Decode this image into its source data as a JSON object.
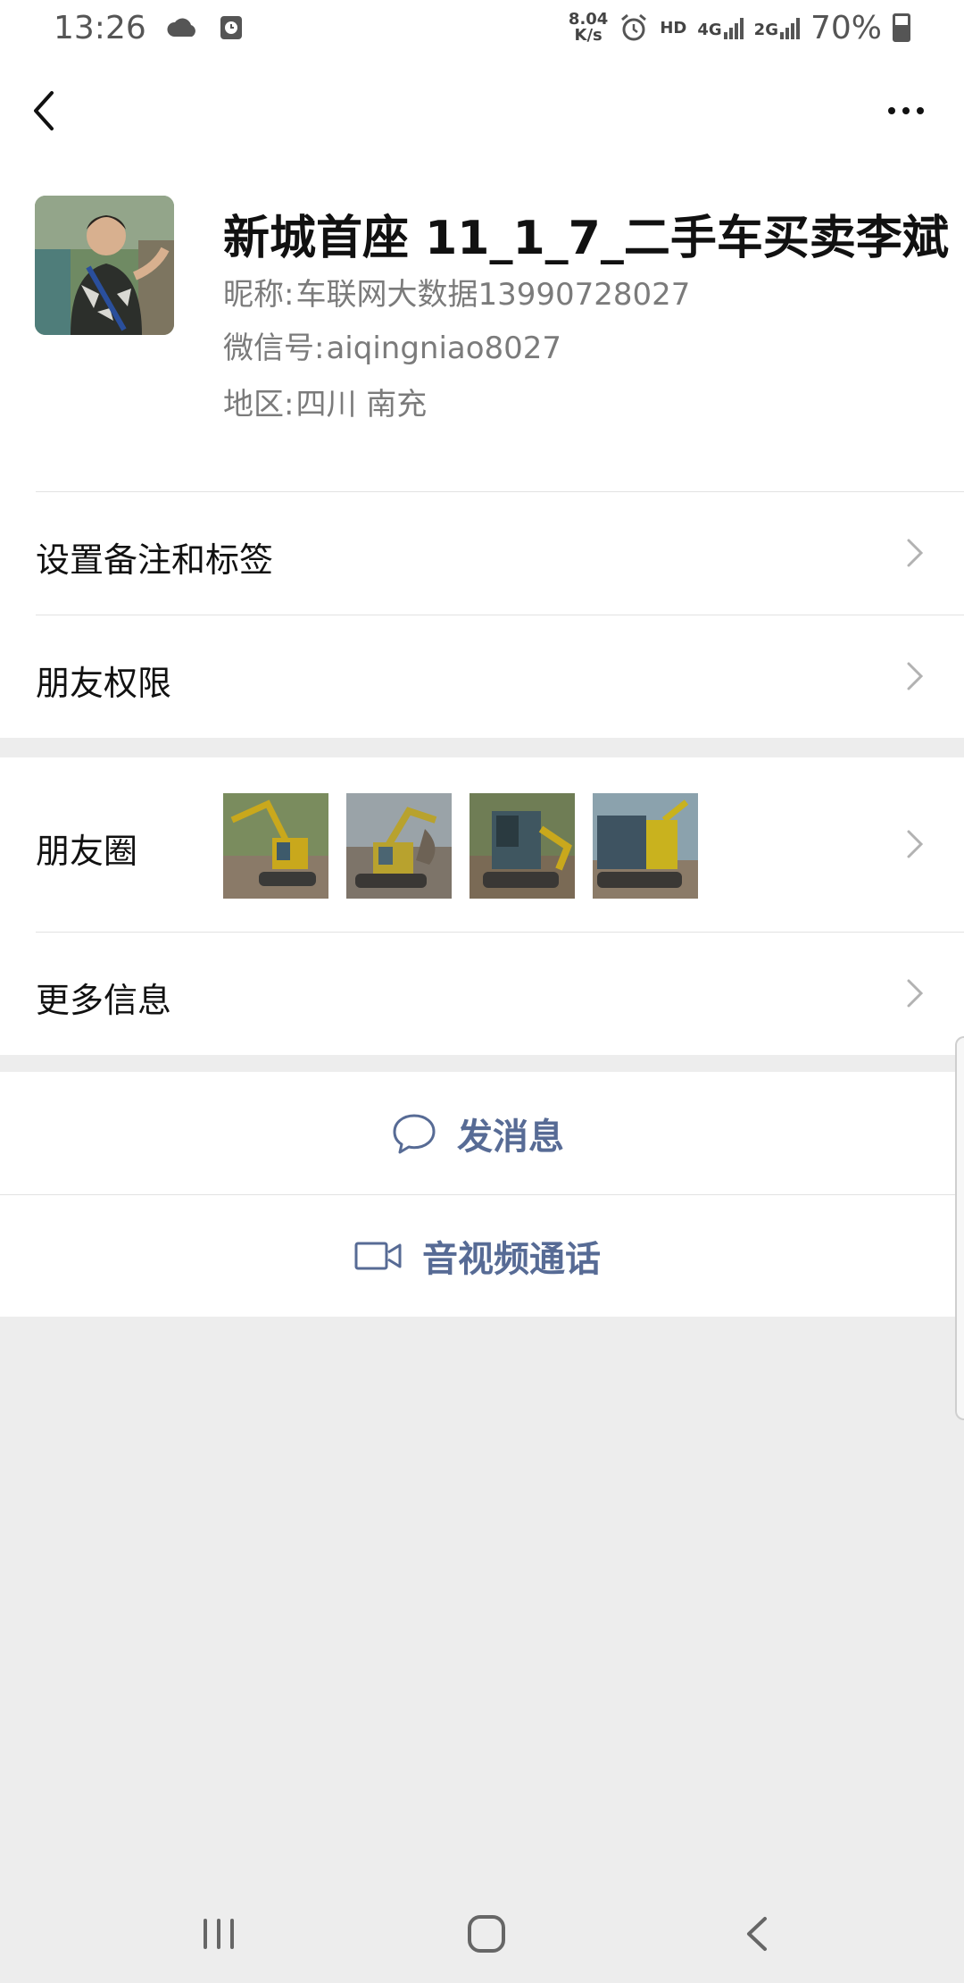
{
  "status_bar": {
    "time": "13:26",
    "net_speed_value": "8.04",
    "net_speed_unit": "K/s",
    "hd_label": "HD",
    "network_label": "4G",
    "network2_label": "2G",
    "battery_percent": "70%"
  },
  "profile": {
    "display_name": "新城首座 11_1_7_二手车买卖李斌",
    "nickname_label": "昵称:",
    "nickname_value": "车联网大数据13990728027",
    "wechat_id_label": "微信号:",
    "wechat_id_value": "aiqingniao8027",
    "region_label": "地区:",
    "region_value": "四川  南充"
  },
  "menu": {
    "remark_tags": "设置备注和标签",
    "friend_permissions": "朋友权限",
    "moments": "朋友圈",
    "more_info": "更多信息"
  },
  "actions": {
    "send_message": "发消息",
    "av_call": "音视频通话"
  },
  "icons": {
    "back": "back-arrow-icon",
    "more": "more-dots-icon",
    "contact_badge": "contact-person-icon",
    "chevron": "chevron-right-icon",
    "message": "chat-bubble-icon",
    "video": "video-camera-icon"
  },
  "colors": {
    "link_blue": "#576b95",
    "background": "#ededed",
    "badge_blue": "#5b8ccf"
  }
}
